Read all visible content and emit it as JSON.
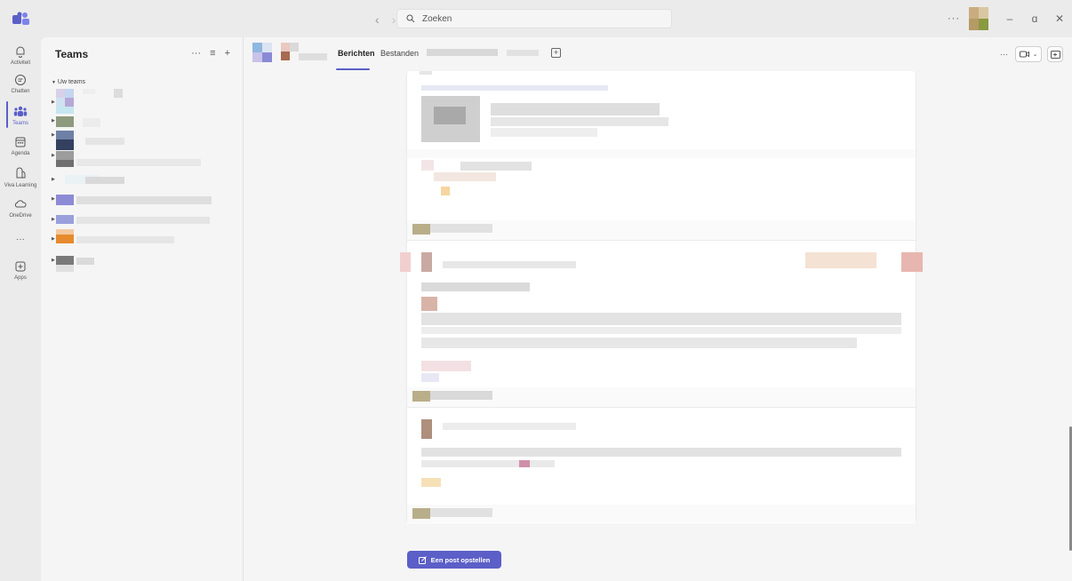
{
  "titlebar": {
    "search_placeholder": "Zoeken",
    "more_label": "···",
    "minimize": "–",
    "restore": "ɑ",
    "close": "✕"
  },
  "rail": {
    "items": [
      {
        "label": "Activiteit",
        "icon": "bell-icon"
      },
      {
        "label": "Chatten",
        "icon": "chat-icon"
      },
      {
        "label": "Teams",
        "icon": "teams-icon"
      },
      {
        "label": "Agenda",
        "icon": "calendar-icon"
      },
      {
        "label": "Viva Learning",
        "icon": "book-icon"
      },
      {
        "label": "OneDrive",
        "icon": "cloud-icon"
      },
      {
        "label": "···",
        "icon": "more-icon"
      },
      {
        "label": "Apps",
        "icon": "apps-icon"
      }
    ]
  },
  "teams_panel": {
    "title": "Teams",
    "more": "···",
    "filter": "≡",
    "add": "+",
    "group_label": "Uw teams"
  },
  "channel": {
    "tabs": [
      {
        "label": "Berichten"
      },
      {
        "label": "Bestanden"
      }
    ],
    "add_tab": "+",
    "more": "···"
  },
  "compose": {
    "label": "Een post opstellen"
  },
  "colors": {
    "accent": "#5b5fc7",
    "rail_bg": "#ebebeb",
    "panel_bg": "#f5f5f5"
  }
}
